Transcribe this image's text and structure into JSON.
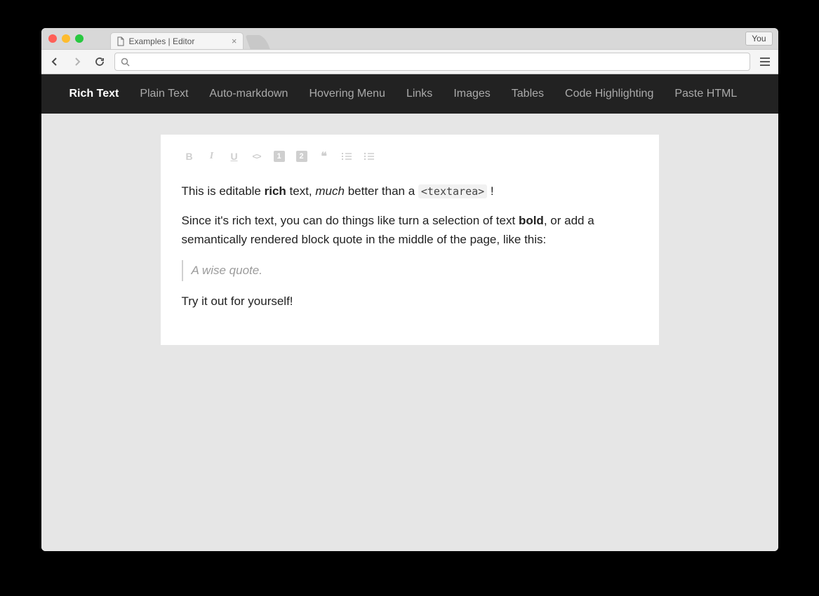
{
  "browser": {
    "tab_title": "Examples | Editor",
    "you_label": "You",
    "url": ""
  },
  "nav": {
    "items": [
      {
        "label": "Rich Text",
        "active": true
      },
      {
        "label": "Plain Text",
        "active": false
      },
      {
        "label": "Auto-markdown",
        "active": false
      },
      {
        "label": "Hovering Menu",
        "active": false
      },
      {
        "label": "Links",
        "active": false
      },
      {
        "label": "Images",
        "active": false
      },
      {
        "label": "Tables",
        "active": false
      },
      {
        "label": "Code Highlighting",
        "active": false
      },
      {
        "label": "Paste HTML",
        "active": false
      }
    ]
  },
  "toolbar": {
    "bold": "B",
    "italic": "I",
    "underline": "U",
    "code": "<>",
    "h1": "1",
    "h2": "2",
    "quote": "❝"
  },
  "editor": {
    "p1_a": "This is editable ",
    "p1_b_strong": "rich",
    "p1_c": " text, ",
    "p1_d_em": "much",
    "p1_e": " better than a ",
    "p1_f_code": "<textarea>",
    "p1_g": " !",
    "p2_a": "Since it's rich text, you can do things like turn a selection of text ",
    "p2_b_strong": "bold",
    "p2_c": ", or add a semantically rendered block quote in the middle of the page, like this:",
    "quote": "A wise quote.",
    "p3": "Try it out for yourself!"
  }
}
